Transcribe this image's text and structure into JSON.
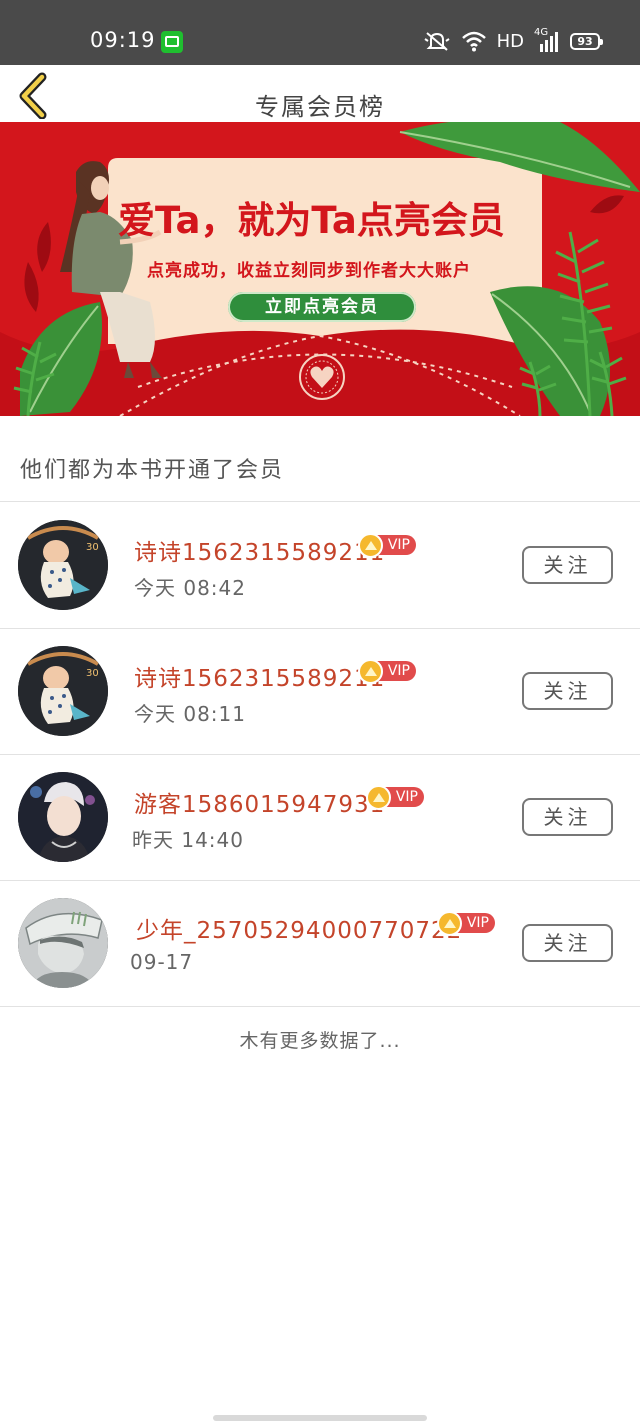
{
  "status_bar": {
    "time": "09:19",
    "network": "HD",
    "signal_label": "4G",
    "battery": "93"
  },
  "header": {
    "title": "专属会员榜",
    "back_icon": "chevron-left-icon"
  },
  "banner": {
    "headline": "爱Ta，就为Ta点亮会员",
    "subtitle": "点亮成功，收益立刻同步到作者大大账户",
    "cta": "立即点亮会员",
    "colors": {
      "background": "#d3161c",
      "card": "#fbe3cc",
      "cta": "#2f8e3c"
    }
  },
  "list": {
    "title": "他们都为本书开通了会员",
    "follow_label": "关注",
    "vip_label": "VIP",
    "items": [
      {
        "name": "诗诗1562315589211",
        "time": "今天  08:42",
        "avatar": "baby-photo"
      },
      {
        "name": "诗诗1562315589211",
        "time": "今天  08:11",
        "avatar": "baby-photo"
      },
      {
        "name": "游客1586015947931",
        "time": "昨天  14:40",
        "avatar": "young-man-photo"
      },
      {
        "name": "少年_25705294000770722",
        "time": "09-17",
        "avatar": "anime-boy-drawing"
      }
    ],
    "end_text": "木有更多数据了..."
  }
}
